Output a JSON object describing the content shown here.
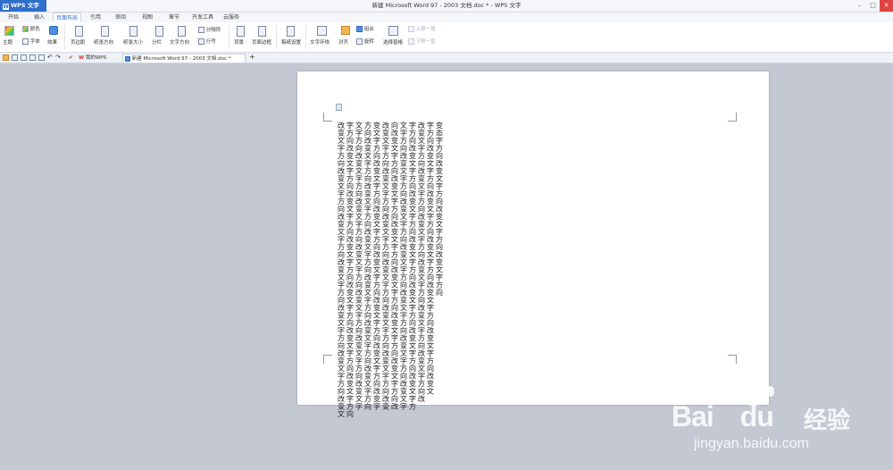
{
  "titlebar": {
    "app_name": "WPS 文字",
    "app_dropdown": "▾",
    "document_title": "新建 Microsoft Word 97 - 2003 文档.doc * - WPS 文字",
    "min": "–",
    "max": "□",
    "close": "✕"
  },
  "tabs": [
    "开始",
    "插入",
    "页面布局",
    "引用",
    "审阅",
    "视图",
    "章节",
    "开发工具",
    "云服务"
  ],
  "ribbon": {
    "theme": "主题",
    "colors": "颜色",
    "fonts": "字体",
    "effects": "效果",
    "margins": "页边距",
    "orientation": "纸张方向",
    "size": "纸张大小",
    "columns": "分栏",
    "text_direction": "文字方向",
    "breaks": "分隔符",
    "line_numbers": "行号",
    "background": "背景",
    "page_borders": "页面边框",
    "draft_settings": "稿纸设置",
    "text_wrap": "文字环绕",
    "align": "对齐",
    "group": "组合",
    "rotate": "旋转",
    "selection_pane": "选择窗格",
    "bring_forward": "上移一层",
    "send_backward": "下移一层"
  },
  "quick_access": {
    "tab_mywps": "我的WPS",
    "tab_doc": "新建 Microsoft Word 97 - 2003 文档.doc *",
    "add_tab": "+"
  },
  "document": {
    "columns": [
      "变态字方向改变文字方向改变文字方向改变文字方向",
      "字方向改变文字方向改变文字方向改变文字方向改变文字方向改变文字方向改变文",
      "改变文字方向改变文字方向改变文字方向改变文字方向改变文字方向改变文字方向改",
      "字方向改变文字方向改变文字方向改变文字方向改变文字方向改变文字方向改变文字方",
      "文字方向改变文字方向改变文字方向改变文字方向改变文字方向改变文字方向改变文字",
      "向改变文字方向改变文字方向改变文字方向改变文字方向改变文字方向改变文字方向改",
      "改变文字方向改变文字方向改变文字方向改变文字方向改变文字方向改变文字方向改变",
      "变文字方向改变文字方向改变文字方向改变文字方向改变文字方向改变文字方向改变字",
      "方向改变文字方向改变文字方向改变文字方向改变文字方向改变文字方向改变文字方向",
      "文字方向改变文字方向改变文字方向改变文字方向改变文字方向改变文字方向改变文字",
      "字方向改变文字方向改变文字方向改变文字方向改变文字方向改变文字方向改变文字方向",
      "改变文字方向改变文字方向改变文字方向改变文字方向改变文字方向改变文字方向改变文"
    ]
  },
  "watermark": {
    "brand": "Bai",
    "brand2": "du",
    "cn": "经验",
    "url": "jingyan.baidu.com"
  }
}
